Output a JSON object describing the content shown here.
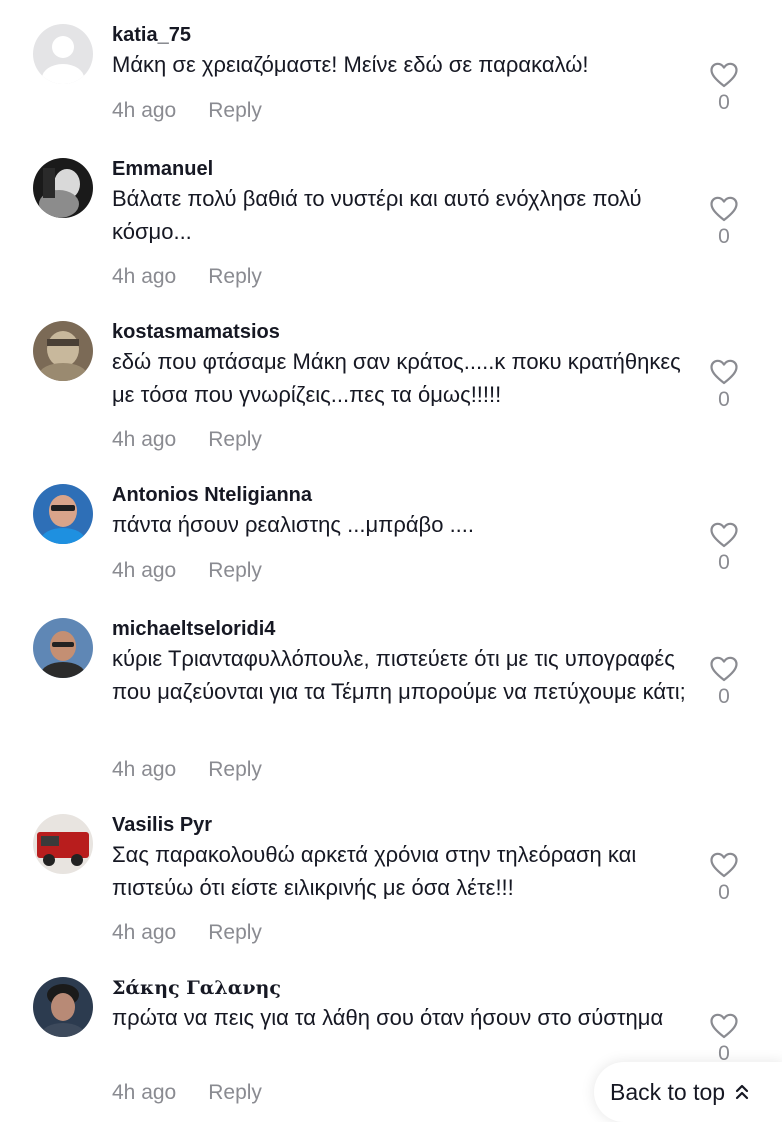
{
  "comments": [
    {
      "username": "katia_75",
      "text": "Μάκη σε χρειαζόμαστε! Μείνε εδώ σε παρακαλώ!",
      "time": "4h ago",
      "reply": "Reply",
      "likes": "0",
      "avatar": "default-avatar"
    },
    {
      "username": "Emmanuel",
      "text": "Βάλατε πολύ βαθιά το νυστέρι και αυτό ενόχλησε πολύ κόσμο...",
      "time": "4h ago",
      "reply": "Reply",
      "likes": "0",
      "avatar": "user-photo"
    },
    {
      "username": "kostasmamatsios",
      "text": "εδώ που φτάσαμε Μάκη σαν κράτος.....κ ποκυ κρατήθηκες με τόσα που γνωρίζεις...πες τα όμως!!!!!",
      "time": "4h ago",
      "reply": "Reply",
      "likes": "0",
      "avatar": "user-photo"
    },
    {
      "username": "Antonios Nteligianna",
      "text": "πάντα ήσουν ρεαλιστης ...μπράβο ....",
      "time": "4h ago",
      "reply": "Reply",
      "likes": "0",
      "avatar": "user-photo"
    },
    {
      "username": "michaeltseloridi4",
      "text": "κύριε Τριανταφυλλόπουλε, πιστεύετε ότι με τις υπογραφές που μαζεύονται για τα Τέμπη μπορούμε να πετύχουμε κάτι;",
      "time": "4h ago",
      "reply": "Reply",
      "likes": "0",
      "avatar": "user-photo"
    },
    {
      "username": "Vasilis Pyr",
      "text": "Σας παρακολουθώ αρκετά χρόνια στην τηλεόραση και πιστεύω ότι είστε ειλικρινής με όσα λέτε!!!",
      "time": "4h ago",
      "reply": "Reply",
      "likes": "0",
      "avatar": "user-photo"
    },
    {
      "username": "Σάκης Γαλανης",
      "text": "πρώτα να πεις για τα λάθη σου όταν ήσουν στο σύστημα",
      "time": "4h ago",
      "reply": "Reply",
      "likes": "0",
      "avatar": "user-photo"
    }
  ],
  "back_to_top": {
    "label": "Back to top",
    "icon": "double-chevron-up-icon"
  },
  "colors": {
    "text": "#161823",
    "muted": "#8a8b91",
    "background": "#ffffff"
  }
}
